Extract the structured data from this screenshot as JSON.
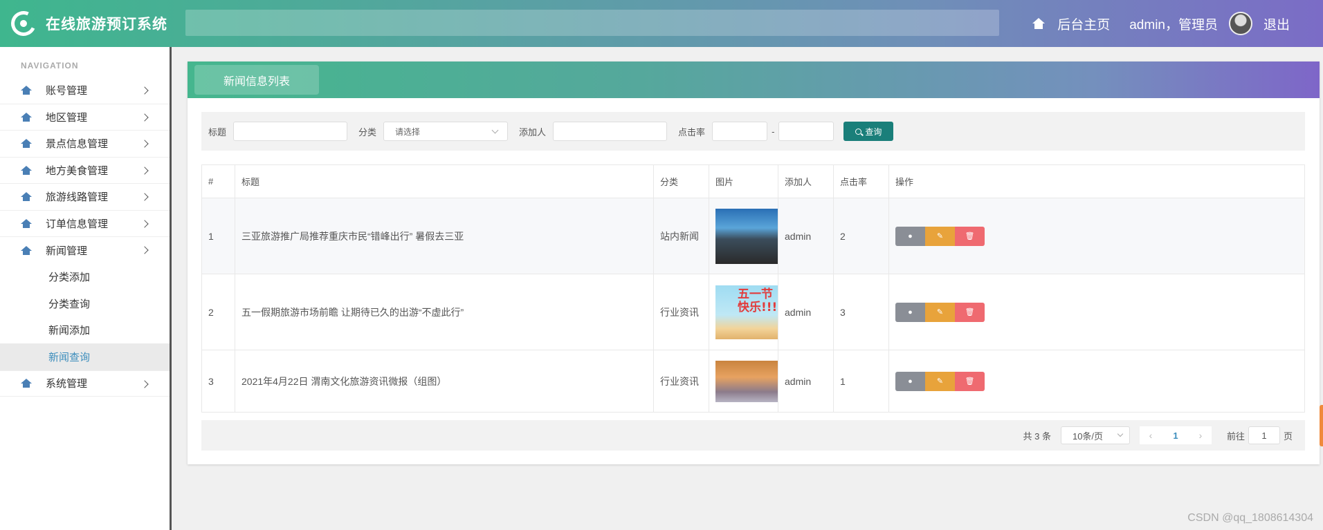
{
  "app": {
    "title": "在线旅游预订系统"
  },
  "header": {
    "home_label": "后台主页",
    "user_label": "admin，管理员",
    "logout_label": "退出"
  },
  "sidebar": {
    "nav_title": "NAVIGATION",
    "items": [
      {
        "label": "账号管理"
      },
      {
        "label": "地区管理"
      },
      {
        "label": "景点信息管理"
      },
      {
        "label": "地方美食管理"
      },
      {
        "label": "旅游线路管理"
      },
      {
        "label": "订单信息管理"
      },
      {
        "label": "新闻管理"
      },
      {
        "label": "系统管理"
      }
    ],
    "sub_items": [
      {
        "label": "分类添加"
      },
      {
        "label": "分类查询"
      },
      {
        "label": "新闻添加"
      },
      {
        "label": "新闻查询",
        "active": true
      }
    ]
  },
  "panel": {
    "tab_label": "新闻信息列表"
  },
  "filter": {
    "title_label": "标题",
    "category_label": "分类",
    "category_placeholder": "请选择",
    "adder_label": "添加人",
    "clicks_label": "点击率",
    "range_sep": "-",
    "query_label": "查询"
  },
  "table": {
    "headers": [
      "#",
      "标题",
      "分类",
      "图片",
      "添加人",
      "点击率",
      "操作"
    ],
    "rows": [
      {
        "no": "1",
        "title": "三亚旅游推广局推荐重庆市民“错峰出行” 暑假去三亚",
        "category": "站内新闻",
        "adder": "admin",
        "clicks": "2"
      },
      {
        "no": "2",
        "title": "五一假期旅游市场前瞻 让期待已久的出游“不虚此行”",
        "category": "行业资讯",
        "adder": "admin",
        "clicks": "3",
        "image_text": "五一节 快乐!!!"
      },
      {
        "no": "3",
        "title": "2021年4月22日 渭南文化旅游资讯微报（组图）",
        "category": "行业资讯",
        "adder": "admin",
        "clicks": "1"
      }
    ]
  },
  "pager": {
    "total": "共 3 条",
    "page_size": "10条/页",
    "current_page": "1",
    "goto_label": "前往",
    "goto_value": "1",
    "page_suffix": "页"
  },
  "watermark": "CSDN @qq_1808614304",
  "colors": {
    "accent_green": "#3fb68e",
    "accent_purple": "#7b6cc6",
    "query_button": "#1a7f7a",
    "info": "#8a8e96",
    "edit": "#e8a33b",
    "delete": "#ef6a70"
  }
}
